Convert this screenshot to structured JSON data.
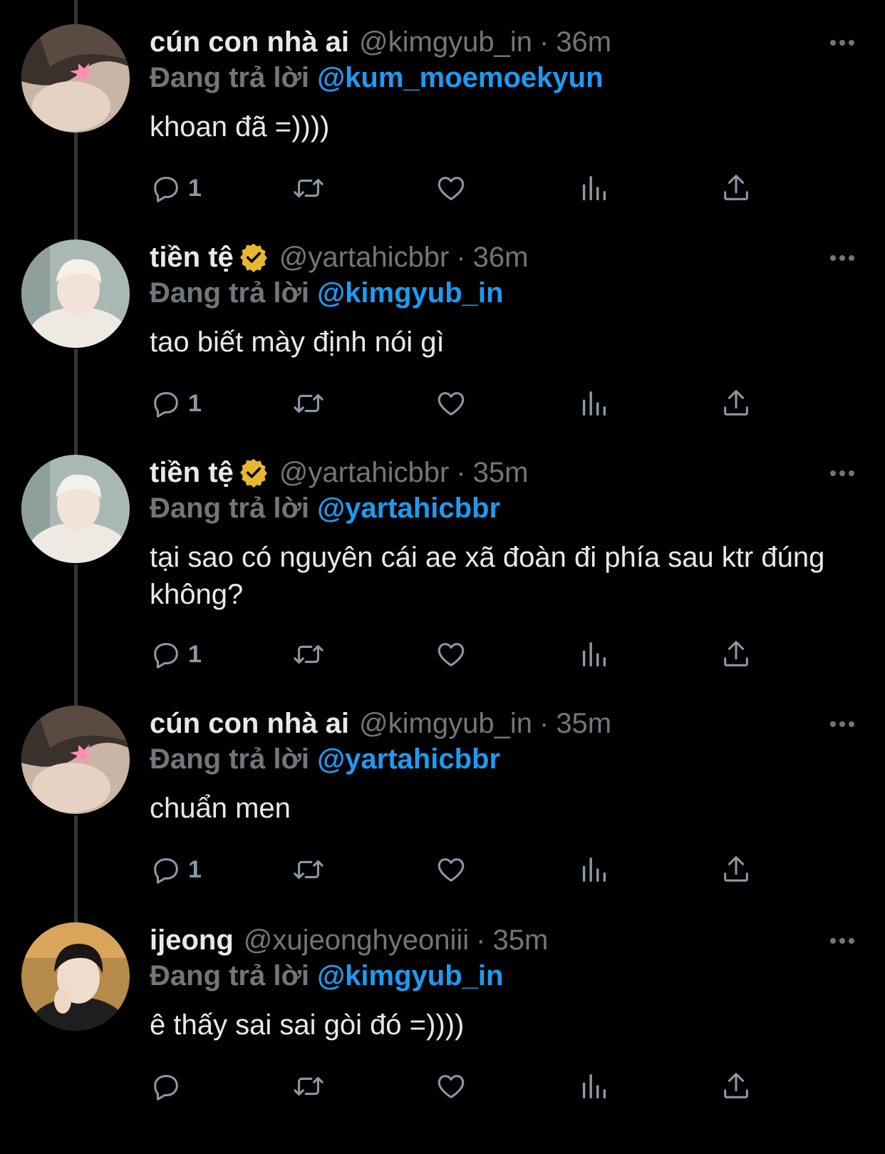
{
  "colors": {
    "background": "#000000",
    "text": "#e7e9ea",
    "muted": "#71767b",
    "mention": "#1d9bf0",
    "verified": "#e8b730",
    "icon": "#8b98a5"
  },
  "tweets": [
    {
      "name": "cún con nhà ai",
      "verified": false,
      "handle": "@kimgyub_in",
      "separator": "·",
      "time": "36m",
      "reply_prefix": "Đang trả lời",
      "reply_to": "@kum_moemoekyun",
      "text": "khoan đã =))))",
      "reply_count": "1",
      "avatar_icon": "avatar-photo"
    },
    {
      "name": "tiền tệ",
      "verified": true,
      "handle": "@yartahicbbr",
      "separator": "·",
      "time": "36m",
      "reply_prefix": "Đang trả lời",
      "reply_to": "@kimgyub_in",
      "text": "tao biết mày định nói gì",
      "reply_count": "1",
      "avatar_icon": "avatar-photo"
    },
    {
      "name": "tiền tệ",
      "verified": true,
      "handle": "@yartahicbbr",
      "separator": "·",
      "time": "35m",
      "reply_prefix": "Đang trả lời",
      "reply_to": "@yartahicbbr",
      "text": "tại sao có nguyên cái ae xã đoàn đi phía sau ktr đúng không?",
      "reply_count": "1",
      "avatar_icon": "avatar-photo"
    },
    {
      "name": "cún con nhà ai",
      "verified": false,
      "handle": "@kimgyub_in",
      "separator": "·",
      "time": "35m",
      "reply_prefix": "Đang trả lời",
      "reply_to": "@yartahicbbr",
      "text": "chuẩn men",
      "reply_count": "1",
      "avatar_icon": "avatar-photo"
    },
    {
      "name": "ijeong",
      "verified": false,
      "handle": "@xujeonghyeoniii",
      "separator": "·",
      "time": "35m",
      "reply_prefix": "Đang trả lời",
      "reply_to": "@kimgyub_in",
      "text": "ê thấy sai sai gòi đó =))))",
      "reply_count": "",
      "avatar_icon": "avatar-photo"
    }
  ]
}
